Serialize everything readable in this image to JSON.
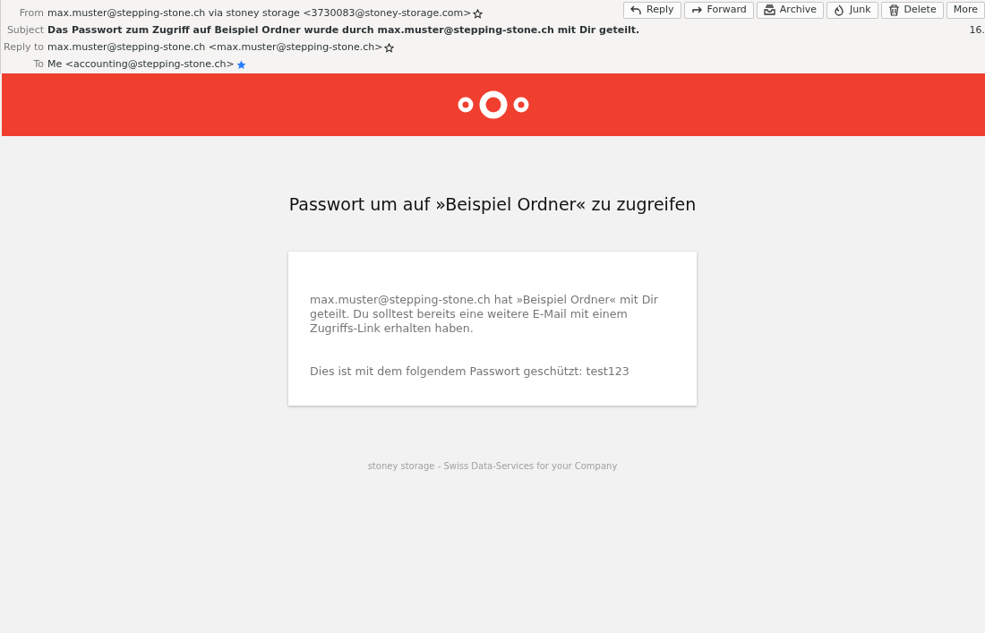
{
  "header": {
    "fields": [
      {
        "label": "From",
        "value": "max.muster@stepping-stone.ch via stoney storage <3730083@stoney-storage.com>",
        "kind": "address",
        "starred": false
      },
      {
        "label": "Subject",
        "value": "Das Passwort zum Zugriff auf Beispiel Ordner wurde durch max.muster@stepping-stone.ch mit Dir geteilt.",
        "kind": "subject"
      },
      {
        "label": "Reply to",
        "value": "max.muster@stepping-stone.ch <max.muster@stepping-stone.ch>",
        "kind": "address",
        "starred": false
      },
      {
        "label": "To",
        "value": "Me <accounting@stepping-stone.ch>",
        "kind": "address",
        "starred": true
      }
    ],
    "date": "16.",
    "buttons": [
      {
        "label": "Reply",
        "kind": "reply"
      },
      {
        "label": "Forward",
        "kind": "forward"
      },
      {
        "label": "Archive",
        "kind": "archive"
      },
      {
        "label": "Junk",
        "kind": "junk"
      },
      {
        "label": "Delete",
        "kind": "delete"
      },
      {
        "label": "More",
        "kind": "more"
      }
    ]
  },
  "message": {
    "title": "Passwort um auf »Beispiel Ordner« zu zugreifen",
    "paragraphs": [
      "max.muster@stepping-stone.ch hat »Beispiel Ordner« mit Dir geteilt. Du solltest bereits eine weitere E-Mail mit einem Zugriffs-Link erhalten haben.",
      "Dies ist mit dem folgendem Passwort geschützt: test123"
    ],
    "footer": "stoney storage - Swiss Data-Services for your Company"
  }
}
